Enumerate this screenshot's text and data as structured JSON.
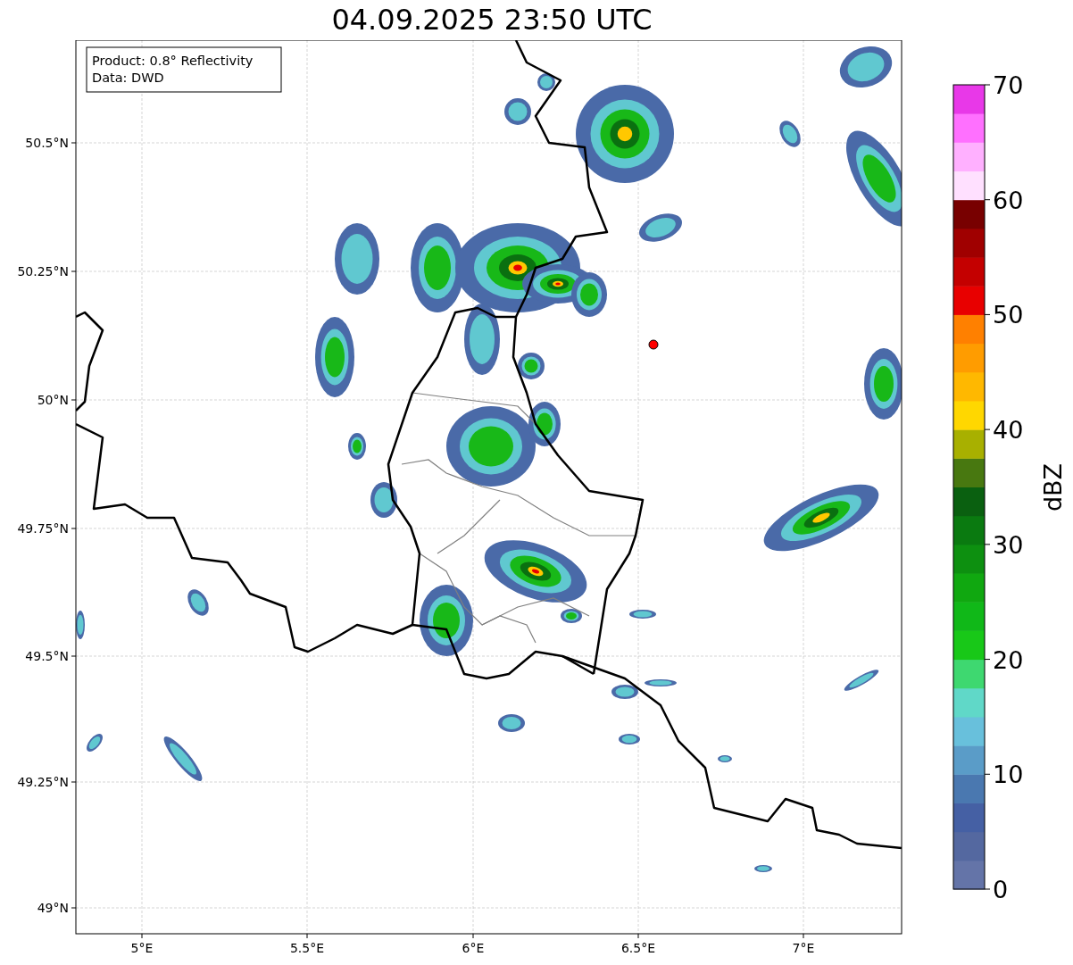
{
  "title": "04.09.2025 23:50 UTC",
  "info_box": [
    "Product: 0.8° Reflectivity",
    "Data: DWD"
  ],
  "x_ticks": [
    "5°E",
    "5.5°E",
    "6°E",
    "6.5°E",
    "7°E"
  ],
  "y_ticks": [
    "50.5°N",
    "50.25°N",
    "50°N",
    "49.75°N",
    "49.5°N",
    "49.25°N",
    "49°N"
  ],
  "colorbar": {
    "label": "dBZ",
    "ticks": [
      "70",
      "60",
      "50",
      "40",
      "30",
      "20",
      "10",
      "0"
    ],
    "segments": [
      {
        "color": "#6474a8"
      },
      {
        "color": "#5468a0"
      },
      {
        "color": "#4560a4"
      },
      {
        "color": "#4a78b0"
      },
      {
        "color": "#5a9cc8"
      },
      {
        "color": "#68c0dc"
      },
      {
        "color": "#60d8c8"
      },
      {
        "color": "#3ed870"
      },
      {
        "color": "#18c818"
      },
      {
        "color": "#10b818"
      },
      {
        "color": "#10a810"
      },
      {
        "color": "#0d9010"
      },
      {
        "color": "#0a7a10"
      },
      {
        "color": "#0a6010"
      },
      {
        "color": "#487810"
      },
      {
        "color": "#a8b000"
      },
      {
        "color": "#ffd700"
      },
      {
        "color": "#ffb800"
      },
      {
        "color": "#ff9c00"
      },
      {
        "color": "#ff8000"
      },
      {
        "color": "#e80000"
      },
      {
        "color": "#c40000"
      },
      {
        "color": "#a00000"
      },
      {
        "color": "#780000"
      },
      {
        "color": "#ffe0ff"
      },
      {
        "color": "#ffb0ff"
      },
      {
        "color": "#ff70ff"
      },
      {
        "color": "#e838e8"
      }
    ]
  }
}
